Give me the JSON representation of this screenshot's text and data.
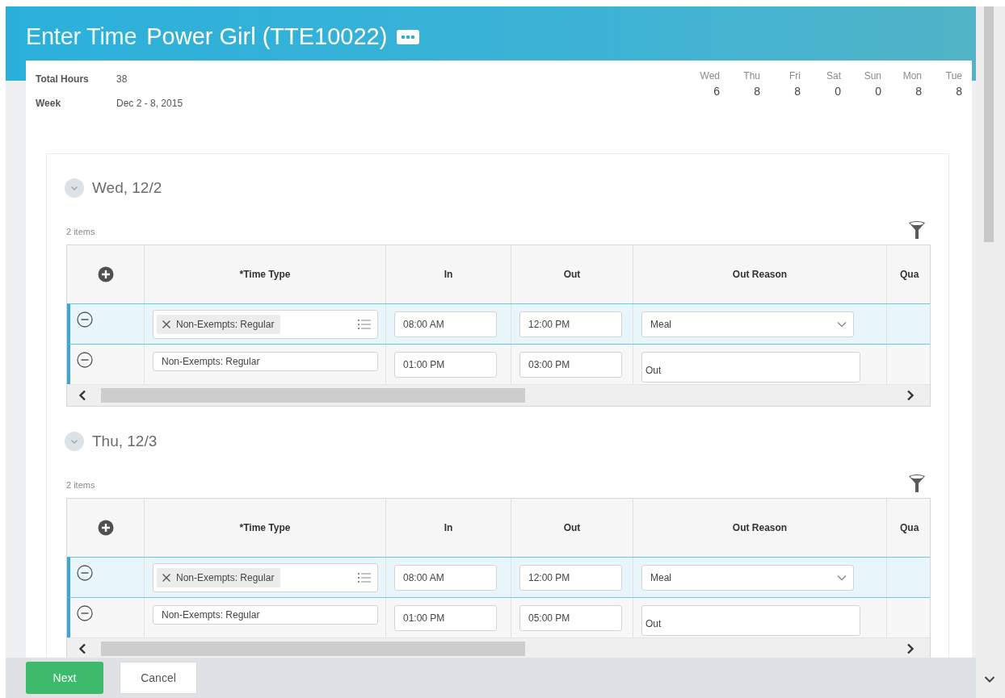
{
  "header": {
    "title": "Enter Time",
    "worker": "Power Girl (TTE10022)"
  },
  "summary": [
    {
      "label": "Total Hours",
      "value": "38"
    },
    {
      "label": "Week",
      "value": "Dec 2 - 8, 2015"
    }
  ],
  "days": [
    {
      "day": "Wed",
      "hours": "6"
    },
    {
      "day": "Thu",
      "hours": "8"
    },
    {
      "day": "Fri",
      "hours": "8"
    },
    {
      "day": "Sat",
      "hours": "0"
    },
    {
      "day": "Sun",
      "hours": "0"
    },
    {
      "day": "Mon",
      "hours": "8"
    },
    {
      "day": "Tue",
      "hours": "8"
    }
  ],
  "sections": [
    {
      "title": "Wed, 12/2",
      "expanded": true,
      "count": "2 items",
      "columns": [
        "*Time Type",
        "In",
        "Out",
        "Out Reason",
        "Qua"
      ],
      "rows": [
        {
          "selected": true,
          "time_type": {
            "text": "Non-Exempts: Regular",
            "kind": "prompt"
          },
          "in": "08:00 AM",
          "out": "12:00 PM",
          "out_reason": {
            "text": "Meal",
            "kind": "select"
          }
        },
        {
          "selected": false,
          "time_type": {
            "text": "Non-Exempts: Regular",
            "kind": "text"
          },
          "in": "01:00 PM",
          "out": "03:00 PM",
          "out_reason": {
            "text": "Out",
            "kind": "text"
          }
        }
      ]
    },
    {
      "title": "Thu, 12/3",
      "expanded": true,
      "count": "2 items",
      "columns": [
        "*Time Type",
        "In",
        "Out",
        "Out Reason",
        "Qua"
      ],
      "rows": [
        {
          "selected": true,
          "time_type": {
            "text": "Non-Exempts: Regular",
            "kind": "prompt"
          },
          "in": "08:00 AM",
          "out": "12:00 PM",
          "out_reason": {
            "text": "Meal",
            "kind": "select"
          }
        },
        {
          "selected": false,
          "time_type": {
            "text": "Non-Exempts: Regular",
            "kind": "text"
          },
          "in": "01:00 PM",
          "out": "05:00 PM",
          "out_reason": {
            "text": "Out",
            "kind": "text"
          }
        }
      ]
    }
  ],
  "buttons": [
    {
      "label": "Next",
      "kind": "primary"
    },
    {
      "label": "Cancel",
      "kind": "secondary"
    }
  ]
}
